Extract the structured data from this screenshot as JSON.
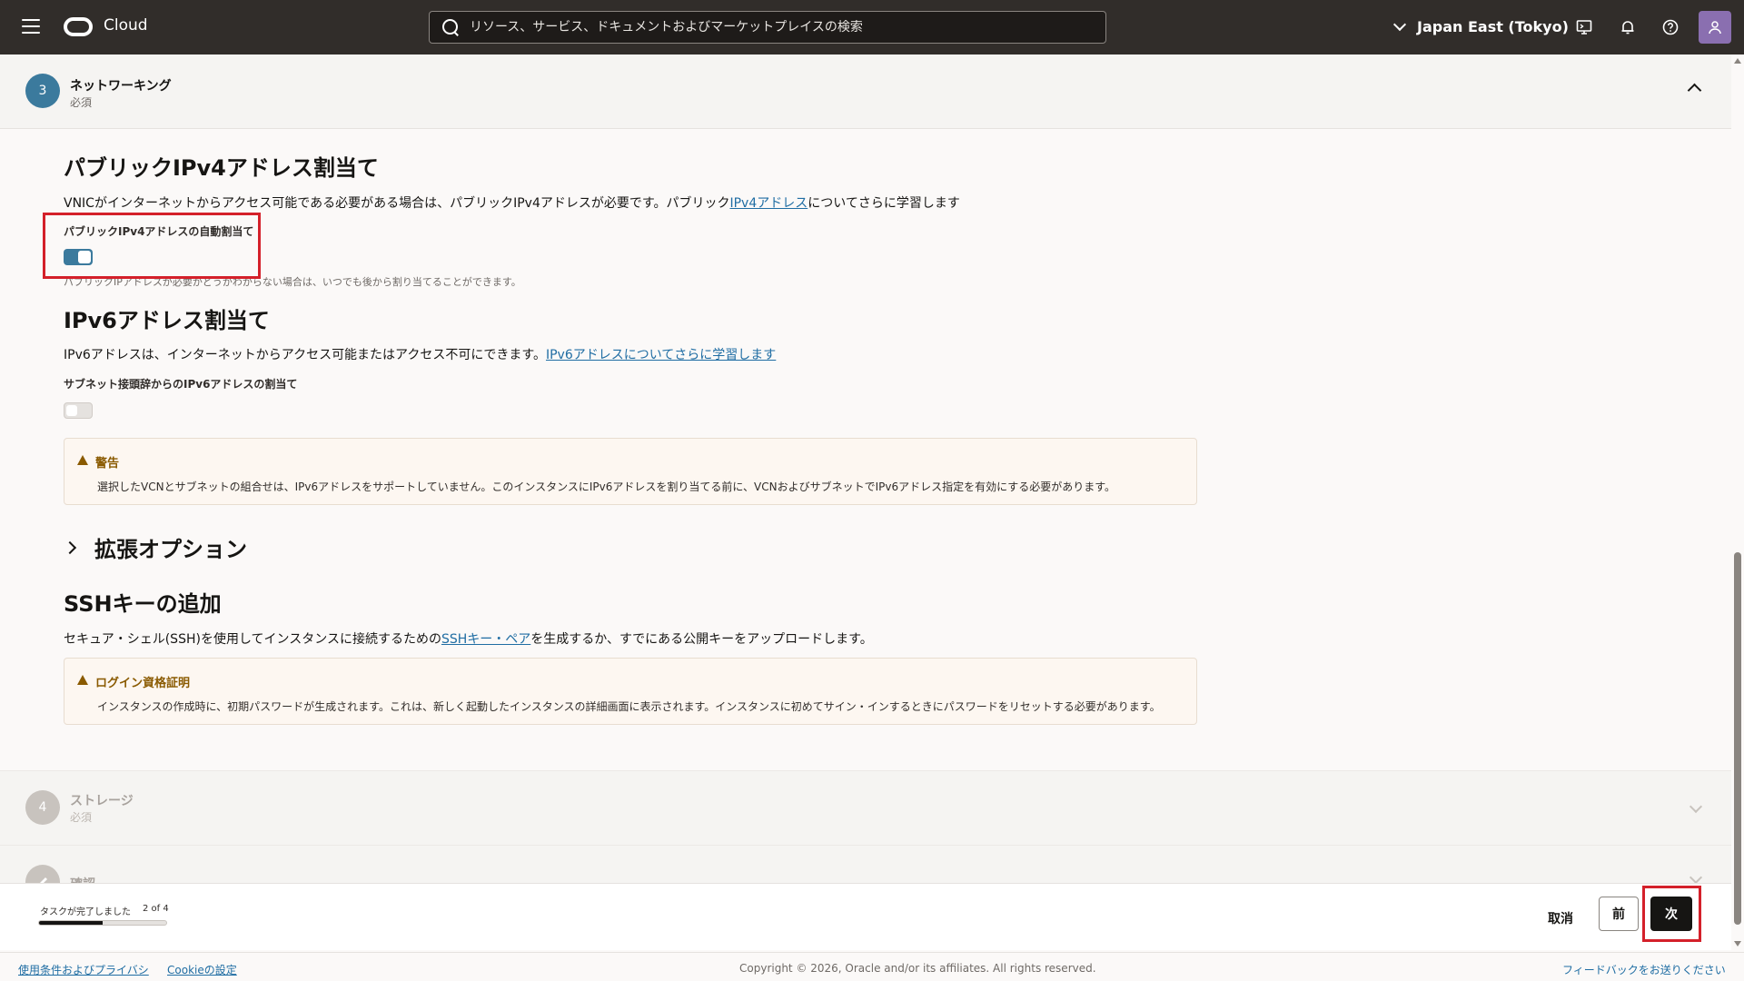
{
  "header": {
    "brand": "Cloud",
    "search_placeholder": "リソース、サービス、ドキュメントおよびマーケットプレイスの検索",
    "region": "Japan East (Tokyo)"
  },
  "step_networking": {
    "number": "3",
    "title": "ネットワーキング",
    "subtitle": "必須"
  },
  "ipv4": {
    "heading": "パブリックIPv4アドレス割当て",
    "description_prefix": "VNICがインターネットからアクセス可能である必要がある場合は、パブリックIPv4アドレスが必要です。パブリック",
    "description_link": "IPv4アドレス",
    "description_suffix": "についてさらに学習します",
    "toggle_label": "パブリックIPv4アドレスの自動割当て",
    "toggle_on": true,
    "hint": "パブリックIPアドレスが必要かどうかわからない場合は、いつでも後から割り当てることができます。"
  },
  "ipv6": {
    "heading": "IPv6アドレス割当て",
    "description_prefix": "IPv6アドレスは、インターネットからアクセス可能またはアクセス不可にできます。",
    "description_link": "IPv6アドレスについてさらに学習します",
    "toggle_label": "サブネット接頭辞からのIPv6アドレスの割当て",
    "toggle_on": false,
    "warning_title": "警告",
    "warning_text": "選択したVCNとサブネットの組合せは、IPv6アドレスをサポートしていません。このインスタンスにIPv6アドレスを割り当てる前に、VCNおよびサブネットでIPv6アドレス指定を有効にする必要があります。"
  },
  "advanced": {
    "label": "拡張オプション"
  },
  "ssh": {
    "heading": "SSHキーの追加",
    "description_prefix": "セキュア・シェル(SSH)を使用してインスタンスに接続するための",
    "description_link": "SSHキー・ペア",
    "description_suffix": "を生成するか、すでにある公開キーをアップロードします。",
    "notice_title": "ログイン資格証明",
    "notice_text": "インスタンスの作成時に、初期パスワードが生成されます。これは、新しく起動したインスタンスの詳細画面に表示されます。インスタンスに初めてサイン・インするときにパスワードをリセットする必要があります。"
  },
  "step_storage": {
    "number": "4",
    "title": "ストレージ",
    "subtitle": "必須"
  },
  "step_review": {
    "title": "確認"
  },
  "progress": {
    "label": "タスクが完了しました",
    "count": "2 of 4",
    "fraction": 0.5
  },
  "buttons": {
    "cancel": "取消",
    "previous": "前",
    "next": "次"
  },
  "footer": {
    "terms": "使用条件およびプライバシ",
    "cookies": "Cookieの設定",
    "copyright": "Copyright © 2026, Oracle and/or its affiliates. All rights reserved.",
    "feedback": "フィードバックをお送りください"
  },
  "colors": {
    "header_bg": "#312d2a",
    "accent": "#3b7a9d",
    "link": "#1f6da3",
    "highlight": "#d4202a",
    "warning": "#8a5a00"
  },
  "icons": {
    "menu": "hamburger-icon",
    "search": "search-icon",
    "region": "chevron-down-icon",
    "cloud_shell": "cloud-shell-icon",
    "notifications": "bell-icon",
    "help": "help-icon",
    "profile": "user-icon"
  }
}
